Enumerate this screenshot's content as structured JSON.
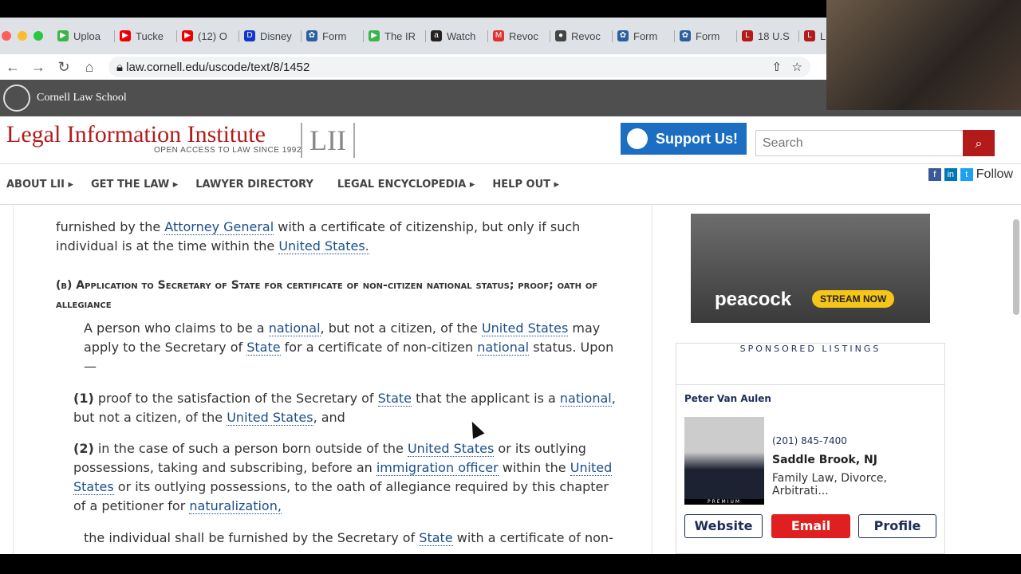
{
  "browser": {
    "tabs": [
      "Uploa",
      "Tucke",
      "(12) O",
      "Disney",
      "Form",
      "The IR",
      "Watch",
      "Revoc",
      "Revoc",
      "Form",
      "Form",
      "18 U.S",
      "LII"
    ],
    "tab_icons": [
      "play-icon",
      "youtube-icon",
      "youtube-icon",
      "disney-icon",
      "seal-icon",
      "play-icon",
      "amazon-icon",
      "gmail-icon",
      "globe-icon",
      "seal-icon",
      "seal-icon",
      "lii-icon",
      "lii-icon"
    ],
    "url": "law.cornell.edu/uscode/text/8/1452"
  },
  "header": {
    "school": "Cornell Law School",
    "title": "Legal Information Institute",
    "subtitle": "OPEN ACCESS TO LAW SINCE 1992",
    "logo": "LII",
    "support": "Support Us!",
    "search_placeholder": "Search",
    "follow": "Follow"
  },
  "nav": [
    "ABOUT LII",
    "GET THE LAW",
    "LAWYER DIRECTORY",
    "LEGAL ENCYCLOPEDIA",
    "HELP OUT"
  ],
  "content": {
    "p1": [
      "furnished by the",
      "Attorney General",
      "with a certificate of citizenship, but only if such individual is at the time within the",
      "United States."
    ],
    "b_heading": "(b) Application to Secretary of State for certificate of non-citizen national status; proof; oath of allegiance",
    "b_text": [
      "A person who claims to be a",
      "national",
      ", but not a citizen, of the",
      "United States",
      "may apply to the Secretary of",
      "State",
      "for a certificate of non-citizen",
      "national",
      "status. Upon —"
    ],
    "i1": [
      "(1)",
      "proof to the satisfaction of the Secretary of",
      "State",
      "that the applicant is a",
      "national",
      ", but not a citizen, of the",
      "United States",
      ", and"
    ],
    "i2": [
      "(2)",
      "in the case of such a person born outside of the",
      "United States",
      "or its outlying possessions, taking and subscribing, before an",
      "immigration officer",
      "within the",
      "United States",
      "or its outlying possessions, to the oath of allegiance required by this chapter of a petitioner for",
      "naturalization,"
    ],
    "p_last": [
      "the individual shall be furnished by the Secretary of",
      "State",
      "with a certificate of non-"
    ]
  },
  "ad": {
    "brand": "peacock",
    "cta": "STREAM NOW"
  },
  "sponsored": {
    "heading": "SPONSORED LISTINGS",
    "name": "Peter Van Aulen",
    "phone": "(201) 845-7400",
    "location": "Saddle Brook, NJ",
    "practice": "Family Law, Divorce, Arbitrati...",
    "badge": "PREMIUM",
    "buttons": [
      "Website",
      "Email",
      "Profile"
    ]
  },
  "colors": {
    "link": "#1a4e8a",
    "brand_red": "#b31b1b",
    "support_blue": "#1b6ec2",
    "email_red": "#e02020"
  }
}
